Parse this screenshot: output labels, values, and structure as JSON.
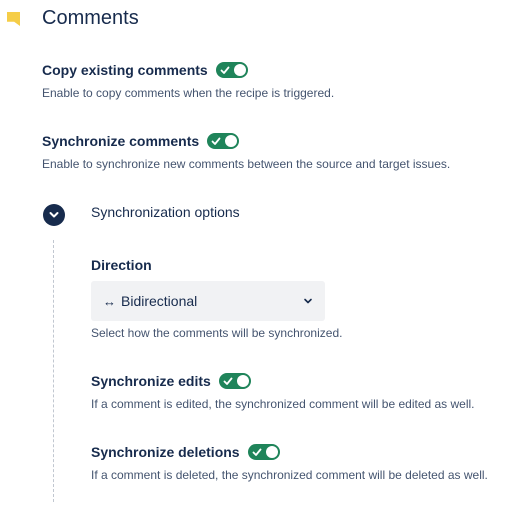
{
  "section": {
    "title": "Comments"
  },
  "copy_existing": {
    "label": "Copy existing comments",
    "description": "Enable to copy comments when the recipe is triggered.",
    "enabled": true
  },
  "synchronize_comments": {
    "label": "Synchronize comments",
    "description": "Enable to synchronize new comments between the source and target issues.",
    "enabled": true
  },
  "sync_options": {
    "label": "Synchronization options",
    "expanded": true
  },
  "direction": {
    "label": "Direction",
    "icon": "↔",
    "value": "Bidirectional",
    "description": "Select how the comments will be synchronized."
  },
  "synchronize_edits": {
    "label": "Synchronize edits",
    "description": "If a comment is edited, the synchronized comment will be edited as well.",
    "enabled": true
  },
  "synchronize_deletions": {
    "label": "Synchronize deletions",
    "description": "If a comment is deleted, the synchronized comment will be deleted as well.",
    "enabled": true
  },
  "colors": {
    "toggle_on": "#1f845a",
    "text_primary": "#172b4d",
    "text_subtle": "#44546f",
    "flag": "#f5cd47"
  }
}
